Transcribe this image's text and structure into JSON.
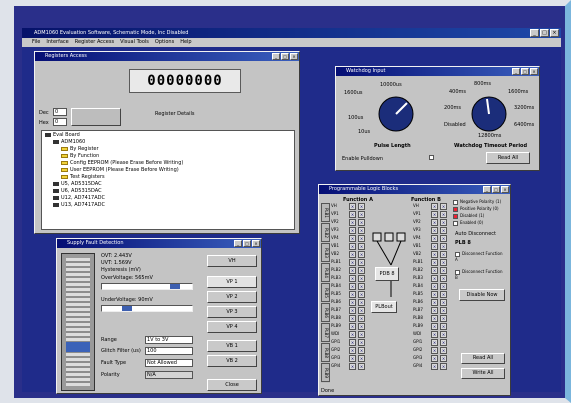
{
  "app": {
    "title": "ADM1060 Evaluation Software, Schematic Mode, Inc Disabled",
    "menus": [
      "File",
      "Interface",
      "Register Access",
      "Visual Tools",
      "Options",
      "Help"
    ]
  },
  "register": {
    "title": "Registers Access",
    "display": "00000000",
    "dec_label": "Dec",
    "hex_label": "Hex",
    "dec_value": "0",
    "hex_value": "0",
    "details_label": "Register Details",
    "tree": [
      "Eval Board",
      "ADM1060",
      "By Register",
      "By Function",
      "Config EEPROM (Please Erase Before Writing)",
      "User EEPROM (Please Erase Before Writing)",
      "Test Registers",
      "U5, AD5315DAC",
      "U6, AD5315DAC",
      "U12, AD7417ADC",
      "U13, AD7417ADC"
    ]
  },
  "watchdog": {
    "title": "Watchdog Input",
    "pulse_label": "Pulse Length",
    "period_label": "Watchdog Timeout Period",
    "pulse_ticks": [
      "1600us",
      "10000us",
      "100us",
      "10us"
    ],
    "period_ticks": [
      "400ms",
      "800ms",
      "1600ms",
      "200ms",
      "3200ms",
      "Disabled",
      "6400ms",
      "12800ms"
    ],
    "enable_label": "Enable Pulldown",
    "read_all": "Read All"
  },
  "supply": {
    "title": "Supply Fault Detection",
    "ovt": "OVT: 2.443V",
    "uvt": "UVT: 1.569V",
    "hysteresis": "Hysteresis (mV)",
    "overvoltage": "OverVoltage: 565mV",
    "undervoltage": "UnderVoltage: 90mV",
    "range_label": "Range",
    "range_value": "1V to 3V",
    "glitch_label": "Glitch Filter (us)",
    "glitch_value": "100",
    "fault_label": "Fault Type",
    "fault_value": "Not Allowed",
    "polarity_label": "Polarity",
    "polarity_value": "N/A",
    "channels": [
      "VH",
      "VP 1",
      "VP 2",
      "VP 3",
      "VP 4",
      "VB 1",
      "VB 2"
    ],
    "close": "Close"
  },
  "pld": {
    "title": "Programmable Logic Blocks",
    "func_a": "Function A",
    "func_b": "Function B",
    "row_labels": [
      "PLB1",
      "PLB2",
      "PLB3",
      "PLB4",
      "PLB5",
      "PLB6",
      "PLB7",
      "PLB8",
      "PLB9"
    ],
    "signals": [
      "VH",
      "VP1",
      "VP2",
      "VP3",
      "VP4",
      "VB1",
      "VB2",
      "PLB1",
      "PLB2",
      "PLB3",
      "PLB4",
      "PLB5",
      "PLB6",
      "PLB7",
      "PLB8",
      "PLB9",
      "WDI",
      "GPI1",
      "GPI2",
      "GPI3",
      "GPI4"
    ],
    "legend": [
      "Negative Polarity (1)",
      "Positive Polarity (0)",
      "Disabled (1)",
      "Enabled (0)"
    ],
    "auto_label": "Auto Disconnect",
    "plb": "PLB 8",
    "disc_a": "Disconnect Function A",
    "disc_b": "Disconnect Function B",
    "disable": "Disable Now",
    "block_main": "PDB 8",
    "block_out": "PLBout",
    "read_all": "Read All",
    "write_all": "Write All",
    "status": "Done"
  },
  "icons": {
    "close": "close-icon",
    "min": "minimize-icon",
    "max": "maximize-icon"
  },
  "colors": {
    "titlebar": "#050e74",
    "desktop": "#1f2b8a",
    "window": "#c4c4c4"
  }
}
